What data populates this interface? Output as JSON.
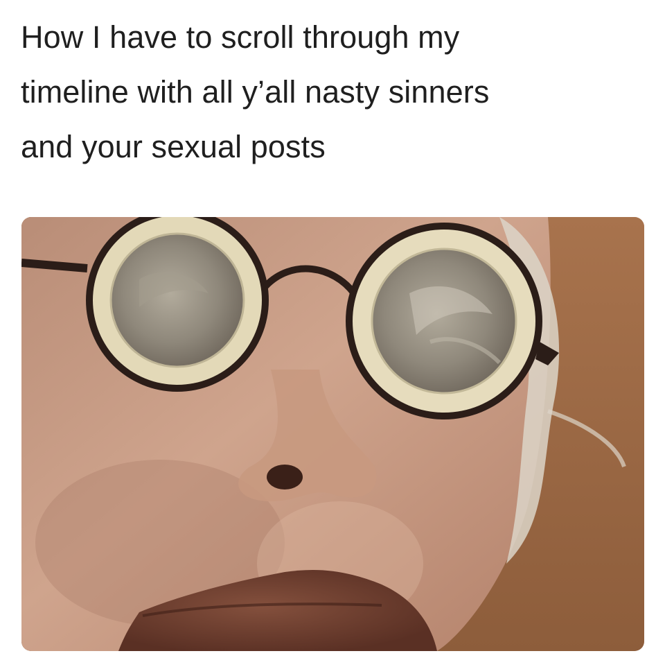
{
  "caption": {
    "lines": [
      "How I have to scroll through my",
      "timeline with all y’all nasty sinners",
      "and your sexual posts"
    ]
  },
  "photo": {
    "subject": "close-up of face wearing round glasses with condoms stretched over the lenses",
    "colors": {
      "skin": "#c9a08a",
      "skin_shadow": "#a57b66",
      "background": "#9a6a45",
      "rims": "#2b1d18",
      "condom_ring": "#e3d9b8",
      "lens": "#8c8478",
      "lips": "#6e3f2f",
      "hair": "#d9d2c4"
    }
  }
}
